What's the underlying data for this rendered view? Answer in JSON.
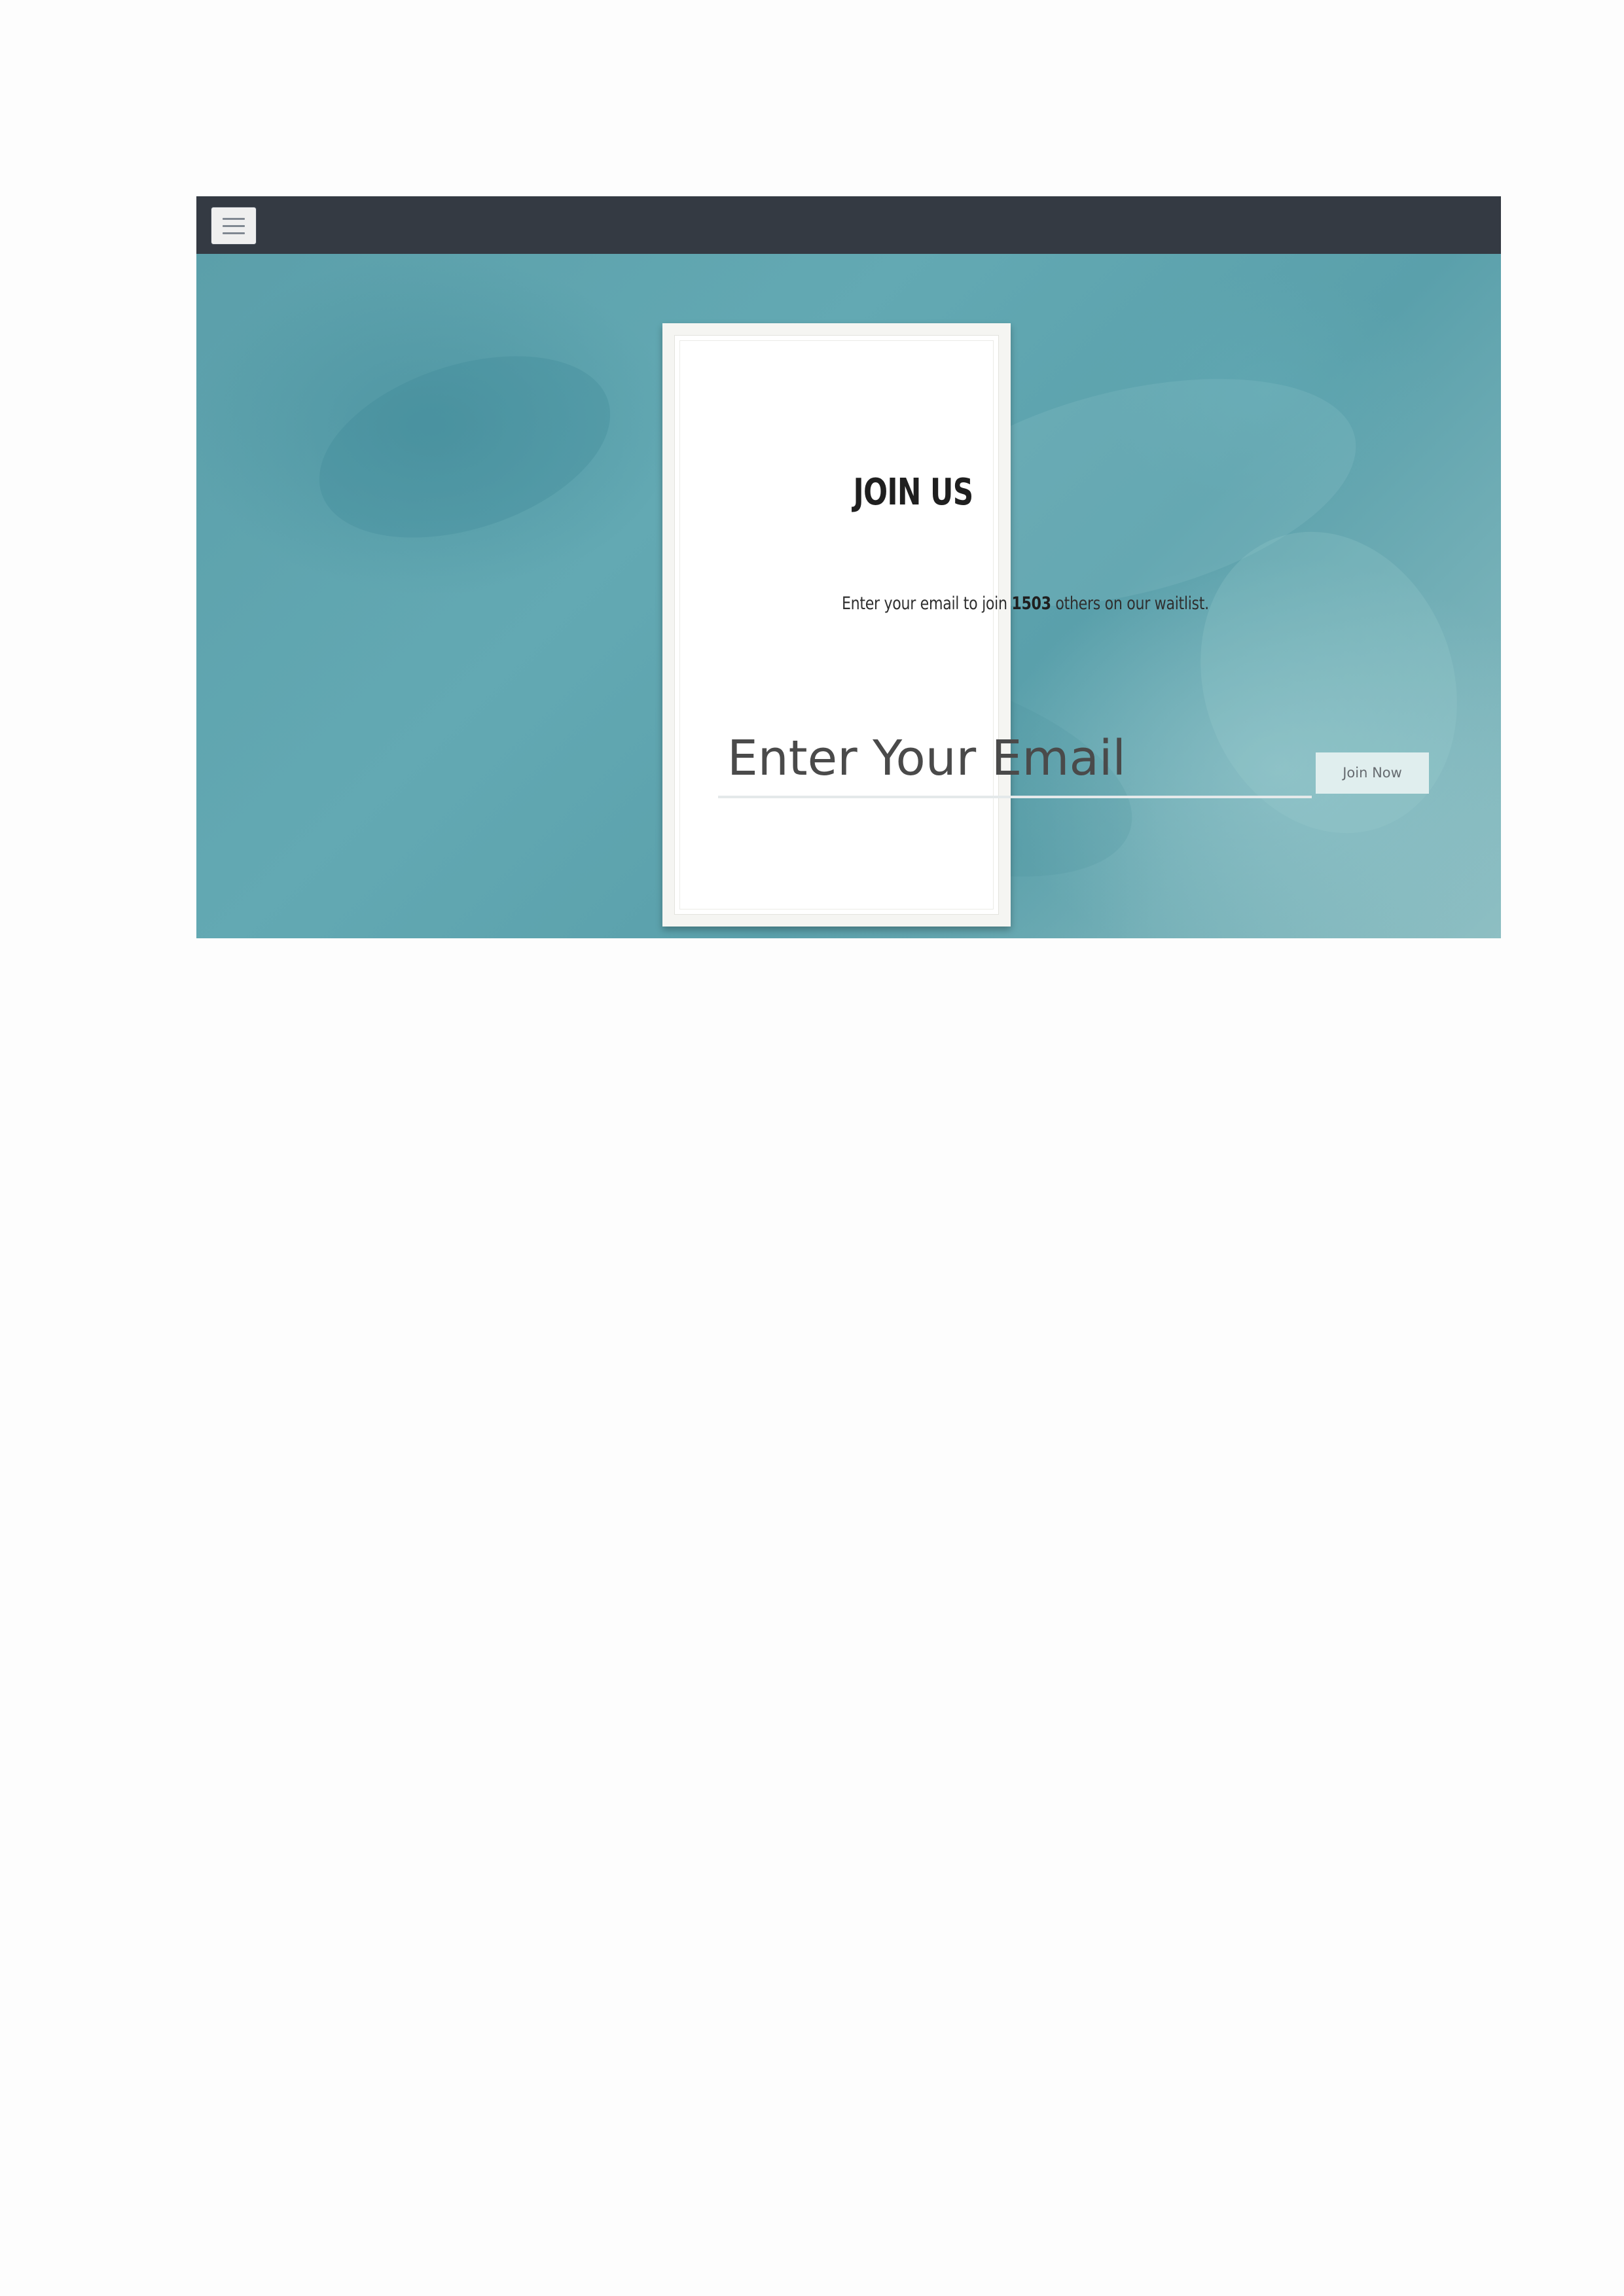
{
  "colors": {
    "page_background": "#fdfdfd",
    "navbar": "#343a43",
    "hero_teal": "#5fa3ae",
    "card": "#ffffff",
    "button": "#e0eeee",
    "text": "#1f1f1f"
  },
  "navbar": {
    "menu_icon": "hamburger-menu-icon"
  },
  "hero": {
    "title": "JOIN US",
    "subtitle": {
      "before": "Enter your email to join ",
      "count": "1503",
      "after": " others on our waitlist."
    },
    "email": {
      "value": "",
      "placeholder": "Enter Your Email"
    },
    "button_label": "Join Now"
  }
}
